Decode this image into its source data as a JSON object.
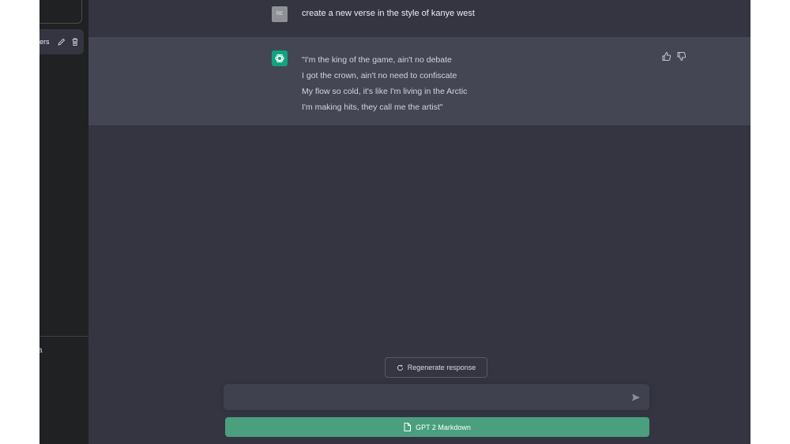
{
  "sidebar": {
    "conversation_title": "ers",
    "edit_icon": "pencil-icon",
    "delete_icon": "trash-icon",
    "bottom_glyph": "a"
  },
  "chat": {
    "user": {
      "avatar_text": "RE",
      "message": "create a new verse in the style of kanye west"
    },
    "assistant": {
      "avatar_icon": "openai-logo-icon",
      "lines": [
        "\"I'm the king of the game, ain't no debate",
        "I got the crown, ain't no need to confiscate",
        "My flow so cold, it's like I'm living in the Arctic",
        "I'm making hits, they call me the artist\""
      ],
      "feedback": {
        "thumbs_up_icon": "thumbs-up-icon",
        "thumbs_down_icon": "thumbs-down-icon"
      }
    }
  },
  "bottom": {
    "regenerate_label": "Regenerate response",
    "input_placeholder": "",
    "send_icon": "send-icon",
    "markdown_button_label": "GPT 2 Markdown"
  },
  "colors": {
    "background": "#343541",
    "sidebar": "#202123",
    "assistant_row": "#444654",
    "accent": "#10a37f",
    "markdown_button": "#4a9f7f"
  }
}
